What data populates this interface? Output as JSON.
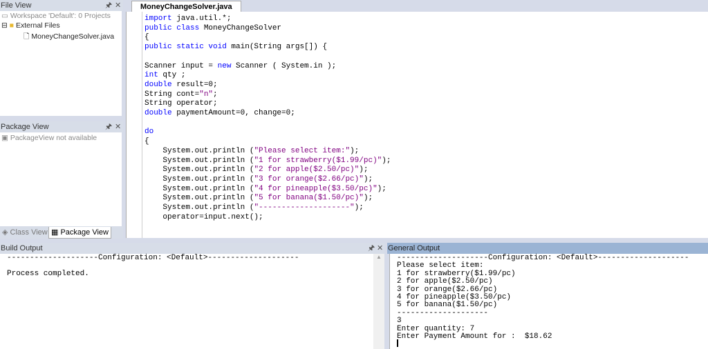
{
  "file_view": {
    "title": "File View",
    "workspace": "Workspace 'Default': 0 Projects",
    "external": "External Files",
    "file": "MoneyChangeSolver.java"
  },
  "package_view": {
    "title": "Package View",
    "message": "PackageView not available"
  },
  "bottom_tabs": {
    "class_view": "Class View",
    "package_view": "Package View"
  },
  "editor": {
    "tab": "MoneyChangeSolver.java",
    "lines": [
      [
        {
          "t": "import",
          "c": "kw"
        },
        {
          "t": " java.util.*;"
        }
      ],
      [
        {
          "t": "public class",
          "c": "kw"
        },
        {
          "t": " MoneyChangeSolver"
        }
      ],
      [
        {
          "t": "{"
        }
      ],
      [
        {
          "t": "public static void",
          "c": "kw"
        },
        {
          "t": " main(String args[]) {"
        }
      ],
      [
        {
          "t": ""
        }
      ],
      [
        {
          "t": "Scanner input = "
        },
        {
          "t": "new",
          "c": "kw"
        },
        {
          "t": " Scanner ( System.in );"
        }
      ],
      [
        {
          "t": "int",
          "c": "kw"
        },
        {
          "t": " qty ;"
        }
      ],
      [
        {
          "t": "double",
          "c": "kw"
        },
        {
          "t": " result=0;"
        }
      ],
      [
        {
          "t": "String cont="
        },
        {
          "t": "\"n\"",
          "c": "str"
        },
        {
          "t": ";"
        }
      ],
      [
        {
          "t": "String operator;"
        }
      ],
      [
        {
          "t": "double",
          "c": "kw"
        },
        {
          "t": " paymentAmount=0, change=0;"
        }
      ],
      [
        {
          "t": ""
        }
      ],
      [
        {
          "t": "do",
          "c": "kw"
        }
      ],
      [
        {
          "t": "{"
        }
      ],
      [
        {
          "t": "    System.out.println ("
        },
        {
          "t": "\"Please select item:\"",
          "c": "str"
        },
        {
          "t": ");"
        }
      ],
      [
        {
          "t": "    System.out.println ("
        },
        {
          "t": "\"1 for strawberry($1.99/pc)\"",
          "c": "str"
        },
        {
          "t": ");"
        }
      ],
      [
        {
          "t": "    System.out.println ("
        },
        {
          "t": "\"2 for apple($2.50/pc)\"",
          "c": "str"
        },
        {
          "t": ");"
        }
      ],
      [
        {
          "t": "    System.out.println ("
        },
        {
          "t": "\"3 for orange($2.66/pc)\"",
          "c": "str"
        },
        {
          "t": ");"
        }
      ],
      [
        {
          "t": "    System.out.println ("
        },
        {
          "t": "\"4 for pineapple($3.50/pc)\"",
          "c": "str"
        },
        {
          "t": ");"
        }
      ],
      [
        {
          "t": "    System.out.println ("
        },
        {
          "t": "\"5 for banana($1.50/pc)\"",
          "c": "str"
        },
        {
          "t": ");"
        }
      ],
      [
        {
          "t": "    System.out.println ("
        },
        {
          "t": "\"--------------------\"",
          "c": "str"
        },
        {
          "t": ");"
        }
      ],
      [
        {
          "t": "    operator=input.next();"
        }
      ]
    ]
  },
  "build_output": {
    "title": "Build Output",
    "lines": [
      "--------------------Configuration: <Default>--------------------",
      "",
      "Process completed."
    ]
  },
  "general_output": {
    "title": "General Output",
    "lines": [
      "--------------------Configuration: <Default>--------------------",
      "Please select item:",
      "1 for strawberry($1.99/pc)",
      "2 for apple($2.50/pc)",
      "3 for orange($2.66/pc)",
      "4 for pineapple($3.50/pc)",
      "5 for banana($1.50/pc)",
      "--------------------",
      "3",
      "Enter quantity: 7",
      "Enter Payment Amount for :  $18.62"
    ]
  }
}
